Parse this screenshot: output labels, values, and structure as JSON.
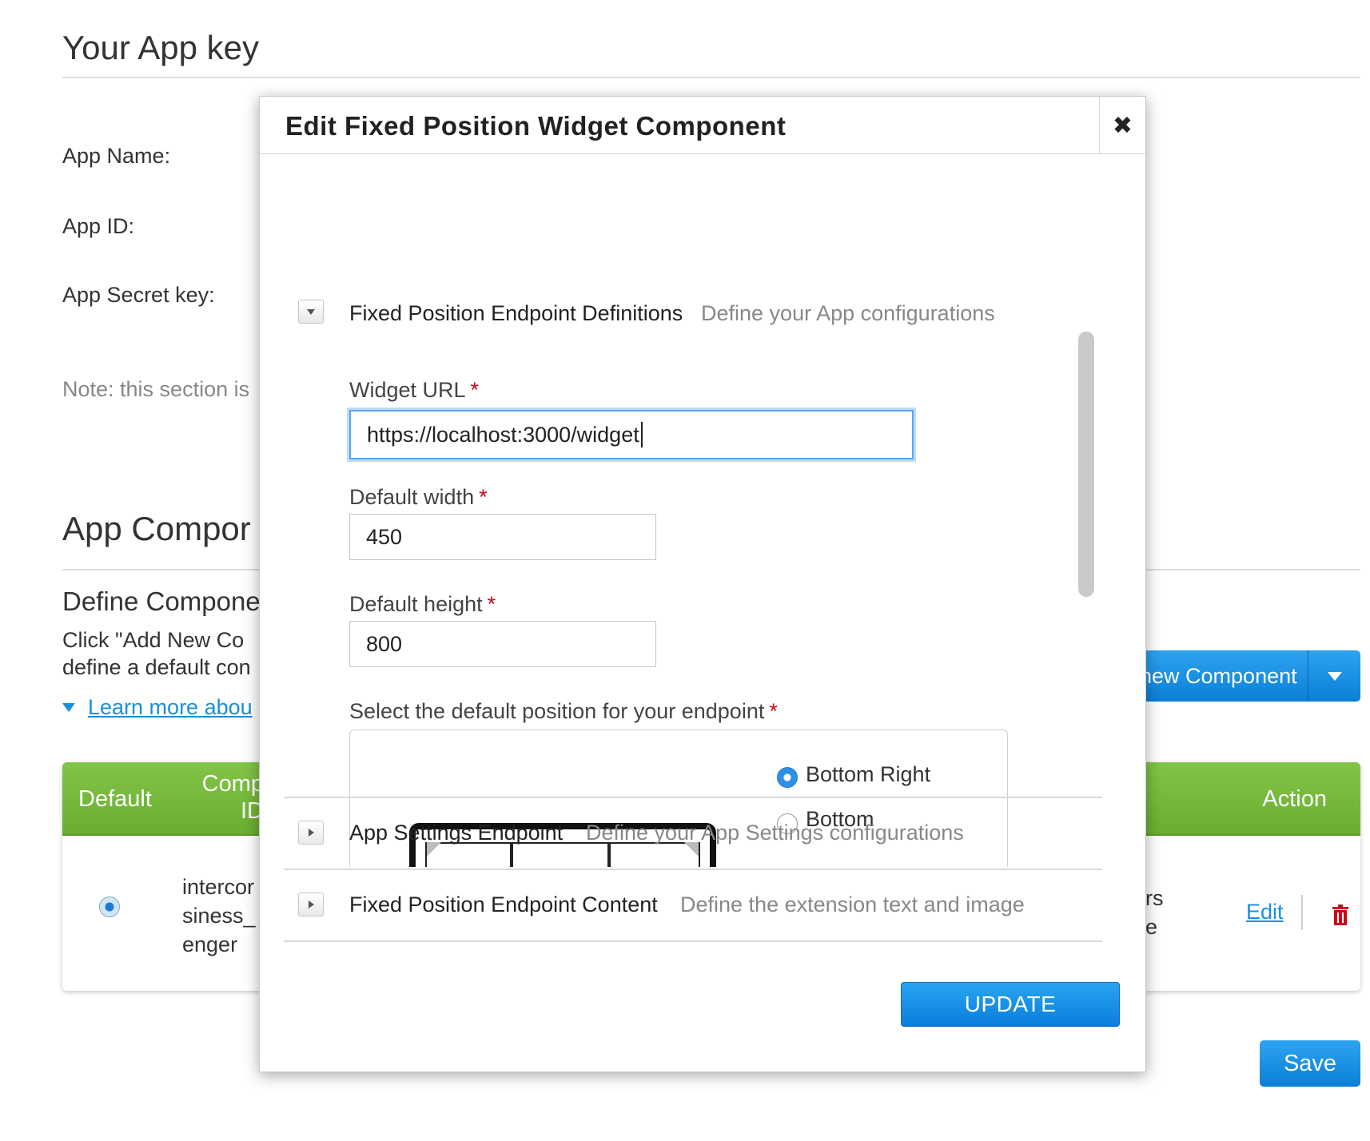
{
  "page": {
    "title": "Your App key",
    "fields": {
      "app_name_label": "App Name:",
      "app_id_label": "App ID:",
      "app_secret_label": "App Secret key:"
    },
    "note": "Note: this section is",
    "components_heading": "App Compor",
    "define_heading": "Define Compone",
    "define_desc_line1": "Click \"Add New Co",
    "define_desc_line2": "define a default con",
    "learn_more": "Learn more abou",
    "add_button_label": "new Component",
    "table": {
      "headers": {
        "default": "Default",
        "component_line1": "Comp",
        "component_line2": "ID",
        "action": "Action"
      },
      "row": {
        "id_lines": [
          "intercor",
          "siness_",
          "enger"
        ],
        "right_lines": [
          "ers",
          "ge"
        ],
        "edit_label": "Edit"
      }
    },
    "save_label": "Save"
  },
  "modal": {
    "title": "Edit Fixed Position Widget Component",
    "close_icon": "close-icon",
    "sections": [
      {
        "title": "Fixed Position Endpoint Definitions",
        "desc": "Define your App configurations",
        "expanded": true
      },
      {
        "title": "App Settings Endpoint",
        "desc": "Define your App Settings configurations",
        "expanded": false
      },
      {
        "title": "Fixed Position Endpoint Content",
        "desc": "Define the extension text and image",
        "expanded": false
      }
    ],
    "form": {
      "widget_url_label": "Widget URL",
      "widget_url_value": "https://localhost:3000/widget",
      "default_width_label": "Default width",
      "default_width_value": "450",
      "default_height_label": "Default height",
      "default_height_value": "800",
      "position_label": "Select the default position for your endpoint",
      "required_mark": "*",
      "position_options": [
        {
          "label": "Bottom Right",
          "selected": true
        },
        {
          "label": "Bottom",
          "selected": false
        }
      ]
    },
    "update_label": "UPDATE"
  },
  "colors": {
    "accent_blue": "#1a8fe0",
    "table_header_green": "#76b83c",
    "required_red": "#d0021b"
  }
}
